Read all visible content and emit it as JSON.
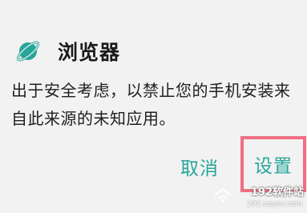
{
  "dialog": {
    "app_icon": "planet-browser-icon",
    "title": "浏览器",
    "message": "出于安全考虑，以禁止您的手机安装来自此来源的未知应用。",
    "cancel_label": "取消",
    "settings_label": "设置"
  },
  "watermark": {
    "brand": "192软件站",
    "url": "192.soyou.com",
    "icon": "wifi-house-icon"
  },
  "colors": {
    "accent": "#26a69a",
    "highlight_box": "#ee6f84",
    "dialog_bg": "#f2f2f2",
    "text": "#202020"
  }
}
